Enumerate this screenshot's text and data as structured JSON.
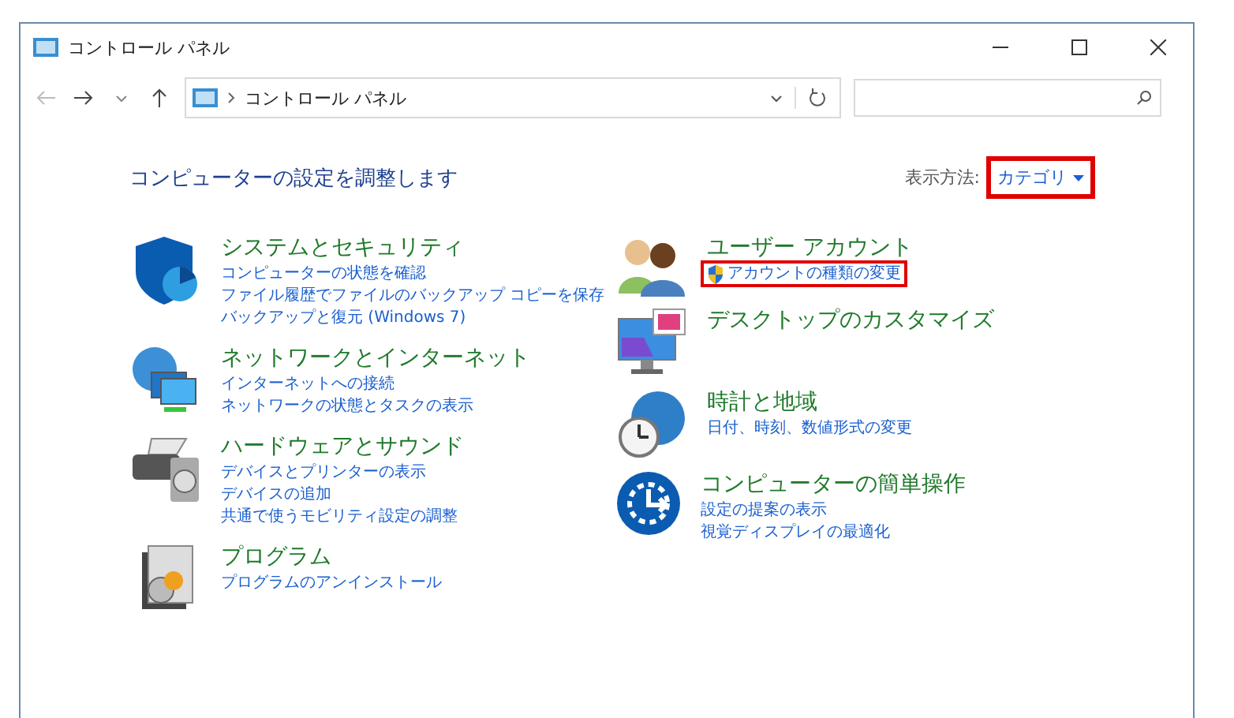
{
  "window": {
    "title": "コントロール パネル"
  },
  "address_bar": {
    "path": "コントロール パネル"
  },
  "heading": "コンピューターの設定を調整します",
  "view_by": {
    "label": "表示方法:",
    "value": "カテゴリ",
    "highlighted": true
  },
  "left_categories": [
    {
      "title": "システムとセキュリティ",
      "links": [
        {
          "text": "コンピューターの状態を確認",
          "shield": false,
          "highlighted": false
        },
        {
          "text": "ファイル履歴でファイルのバックアップ コピーを保存",
          "shield": false,
          "highlighted": false
        },
        {
          "text": "バックアップと復元 (Windows 7)",
          "shield": false,
          "highlighted": false
        }
      ]
    },
    {
      "title": "ネットワークとインターネット",
      "links": [
        {
          "text": "インターネットへの接続",
          "shield": false,
          "highlighted": false
        },
        {
          "text": "ネットワークの状態とタスクの表示",
          "shield": false,
          "highlighted": false
        }
      ]
    },
    {
      "title": "ハードウェアとサウンド",
      "links": [
        {
          "text": "デバイスとプリンターの表示",
          "shield": false,
          "highlighted": false
        },
        {
          "text": "デバイスの追加",
          "shield": false,
          "highlighted": false
        },
        {
          "text": "共通で使うモビリティ設定の調整",
          "shield": false,
          "highlighted": false
        }
      ]
    },
    {
      "title": "プログラム",
      "links": [
        {
          "text": "プログラムのアンインストール",
          "shield": false,
          "highlighted": false
        }
      ]
    }
  ],
  "right_categories": [
    {
      "title": "ユーザー アカウント",
      "links": [
        {
          "text": "アカウントの種類の変更",
          "shield": true,
          "highlighted": true
        }
      ]
    },
    {
      "title": "デスクトップのカスタマイズ"
    },
    {
      "title": "時計と地域",
      "links": [
        {
          "text": "日付、時刻、数値形式の変更",
          "shield": false,
          "highlighted": false
        }
      ]
    },
    {
      "title": "コンピューターの簡単操作",
      "links": [
        {
          "text": "設定の提案の表示",
          "shield": false,
          "highlighted": false
        },
        {
          "text": "視覚ディスプレイの最適化",
          "shield": false,
          "highlighted": false
        }
      ]
    }
  ]
}
